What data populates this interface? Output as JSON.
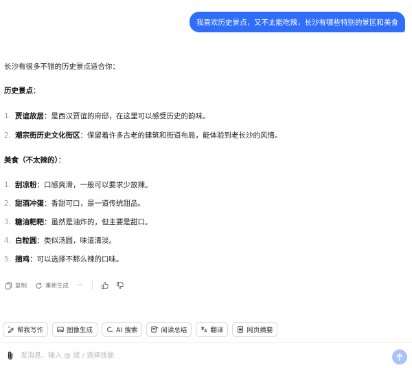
{
  "user_message": "我喜欢历史景点，又不太能吃辣，长沙有哪些特别的景区和美食",
  "answer": {
    "intro": "长沙有很多不错的历史景点适合你：",
    "sections": [
      {
        "heading": "历史景点",
        "heading_suffix": "：",
        "items": [
          {
            "num": "1.",
            "name": "贾谊故居",
            "desc": "：是西汉贾谊的府邸，在这里可以感受历史的韵味。"
          },
          {
            "num": "2.",
            "name": "潮宗街历史文化街区",
            "desc": "：保留着许多古老的建筑和街道布局，能体验到老长沙的风情。"
          }
        ]
      },
      {
        "heading": "美食（不太辣的）",
        "heading_suffix": "：",
        "items": [
          {
            "num": "1.",
            "name": "刮凉粉",
            "desc": "：口感爽滑，一般可以要求少放辣。"
          },
          {
            "num": "2.",
            "name": "甜酒冲蛋",
            "desc": "：香甜可口，是一道传统甜品。"
          },
          {
            "num": "3.",
            "name": "糖油粑粑",
            "desc": "：虽然是油炸的，但主要是甜口。"
          },
          {
            "num": "4.",
            "name": "白粒圆",
            "desc": "：类似汤圆，味道清淡。"
          },
          {
            "num": "5.",
            "name": "捆鸡",
            "desc": "：可以选择不那么辣的口味。"
          }
        ]
      }
    ]
  },
  "actions": {
    "copy": "复制",
    "regenerate": "重新生成",
    "more": "···"
  },
  "skills": [
    {
      "icon": "pen-icon",
      "label": "帮我写作"
    },
    {
      "icon": "image-icon",
      "label": "图像生成"
    },
    {
      "icon": "ai-search-icon",
      "label": "AI 搜索"
    },
    {
      "icon": "reading-summary-icon",
      "label": "阅读总结"
    },
    {
      "icon": "translate-icon",
      "label": "翻译"
    },
    {
      "icon": "webpage-summary-icon",
      "label": "网页摘要"
    }
  ],
  "composer": {
    "placeholder": "发消息、输入 @ 或 / 选择技能"
  },
  "colors": {
    "accent": "#2f6dfb",
    "send_disabled": "#a9c4fb"
  }
}
